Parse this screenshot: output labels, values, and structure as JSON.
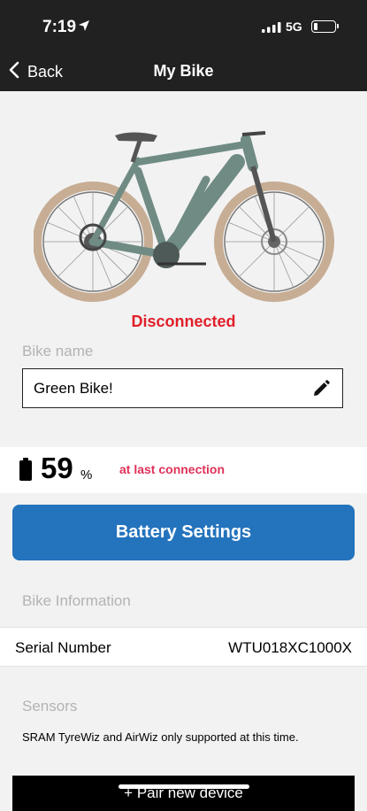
{
  "status_bar": {
    "time": "7:19",
    "network": "5G"
  },
  "nav": {
    "back_label": "Back",
    "title": "My Bike"
  },
  "bike": {
    "connection_status": "Disconnected"
  },
  "bike_name": {
    "label": "Bike name",
    "value": "Green Bike!"
  },
  "battery": {
    "percent": "59",
    "unit": "%",
    "note": "at last connection"
  },
  "buttons": {
    "battery_settings": "Battery Settings",
    "pair_new_device": "+ Pair new device"
  },
  "bike_information": {
    "header": "Bike Information",
    "serial_label": "Serial Number",
    "serial_value": "WTU018XC1000X"
  },
  "sensors": {
    "header": "Sensors",
    "note": "SRAM TyreWiz and AirWiz only supported at this time."
  },
  "colors": {
    "accent": "#2373bd",
    "disconnected": "#e01f2a",
    "last_connection": "#e0315a"
  }
}
